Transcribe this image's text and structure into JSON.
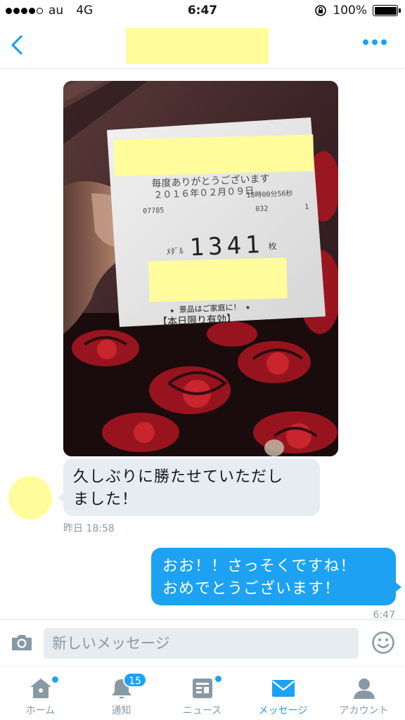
{
  "status_bar": {
    "carrier": "au",
    "network": "4G",
    "time": "6:47",
    "battery": "100%"
  },
  "header": {
    "back_icon": "chevron-left-icon",
    "more_icon": "more-dots-icon"
  },
  "receipt": {
    "thanks": "毎度ありがとうございます",
    "date": "２０１６年０２月０９日",
    "time_code": "18時00分56秒",
    "code_left": "07785",
    "code_mid": "032",
    "code_right": "1",
    "medal_label": "ﾒﾀﾞﾙ",
    "count": "1341",
    "unit": "枚",
    "notice": "★ 景品はご家庭に！ ★",
    "valid": "【本日限り有効】"
  },
  "messages": [
    {
      "direction": "incoming",
      "lines": [
        "久しぶりに勝たせていただし",
        "ました！"
      ],
      "time": "昨日 18:58"
    },
    {
      "direction": "outgoing",
      "lines": [
        "おお！！さっそくですね！",
        "おめでとうございます！"
      ],
      "time": "6:47"
    }
  ],
  "composer": {
    "placeholder": "新しいメッセージ"
  },
  "tabs": [
    {
      "label": "ホーム",
      "icon": "home-icon",
      "dot": true
    },
    {
      "label": "通知",
      "icon": "bell-icon",
      "badge": "15"
    },
    {
      "label": "ニュース",
      "icon": "news-icon",
      "dot": true
    },
    {
      "label": "メッセージ",
      "icon": "envelope-icon",
      "active": true
    },
    {
      "label": "アカウント",
      "icon": "person-icon"
    }
  ],
  "colors": {
    "accent": "#1da1f2",
    "redaction": "#fffc9b",
    "bubble_incoming": "#e6ecf0"
  }
}
